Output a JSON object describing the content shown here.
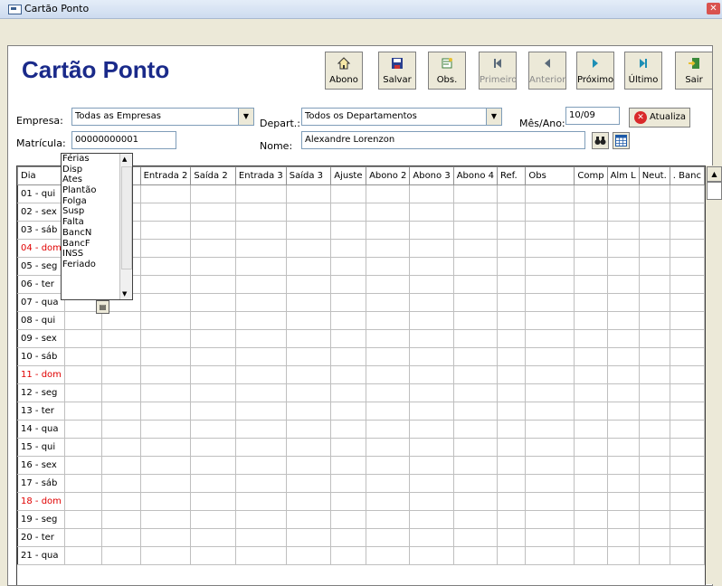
{
  "window": {
    "title": "Cartão Ponto",
    "close": "✕"
  },
  "header": {
    "title": "Cartão Ponto"
  },
  "toolbar": [
    {
      "label": "Abono",
      "icon": "house-icon",
      "enabled": true
    },
    {
      "label": "Salvar",
      "icon": "floppy-disk-icon",
      "enabled": true
    },
    {
      "label": "Obs.",
      "icon": "notes-icon",
      "enabled": true
    },
    {
      "label": "Primeiro",
      "icon": "first-record-icon",
      "enabled": false
    },
    {
      "label": "Anterior",
      "icon": "previous-record-icon",
      "enabled": false
    },
    {
      "label": "Próximo",
      "icon": "next-record-icon",
      "enabled": true
    },
    {
      "label": "Último",
      "icon": "last-record-icon",
      "enabled": true
    },
    {
      "label": "Sair",
      "icon": "exit-door-icon",
      "enabled": true
    }
  ],
  "form": {
    "empresa_label": "Empresa:",
    "empresa_value": "Todas as Empresas",
    "depart_label": "Depart.:",
    "depart_value": "Todos os Departamentos",
    "mesano_label": "Mês/Ano:",
    "mesano_value": "10/09",
    "atualiza_label": "Atualiza",
    "matricula_label": "Matrícula:",
    "matricula_value": "00000000001",
    "nome_label": "Nome:",
    "nome_value": "Alexandre Lorenzon"
  },
  "grid": {
    "headers": [
      "Dia",
      "",
      "1",
      "Entrada 2",
      "Saída 2",
      "Entrada 3",
      "Saída 3",
      "Ajuste",
      "Abono 2",
      "Abono 3",
      "Abono 4",
      "Ref.",
      "Obs",
      "Comp",
      "Alm L",
      "Neut.",
      ". Banc"
    ],
    "days": [
      {
        "label": "01 - qui",
        "sunday": false
      },
      {
        "label": "02 - sex",
        "sunday": false
      },
      {
        "label": "03 - sáb",
        "sunday": false
      },
      {
        "label": "04 - dom",
        "sunday": true
      },
      {
        "label": "05 - seg",
        "sunday": false
      },
      {
        "label": "06 - ter",
        "sunday": false
      },
      {
        "label": "07 - qua",
        "sunday": false
      },
      {
        "label": "08 - qui",
        "sunday": false
      },
      {
        "label": "09 - sex",
        "sunday": false
      },
      {
        "label": "10 - sáb",
        "sunday": false
      },
      {
        "label": "11 - dom",
        "sunday": true
      },
      {
        "label": "12 - seg",
        "sunday": false
      },
      {
        "label": "13 - ter",
        "sunday": false
      },
      {
        "label": "14 - qua",
        "sunday": false
      },
      {
        "label": "15 - qui",
        "sunday": false
      },
      {
        "label": "16 - sex",
        "sunday": false
      },
      {
        "label": "17 - sáb",
        "sunday": false
      },
      {
        "label": "18 - dom",
        "sunday": true
      },
      {
        "label": "19 - seg",
        "sunday": false
      },
      {
        "label": "20 - ter",
        "sunday": false
      },
      {
        "label": "21 - qua",
        "sunday": false
      }
    ]
  },
  "dropdown": {
    "items": [
      "Férias",
      "Disp",
      "Ates",
      "Plantão",
      "Folga",
      "Susp",
      "Falta",
      "BancN",
      "BancF",
      "INSS",
      "Feriado"
    ]
  },
  "colors": {
    "title": "#1a2a8a",
    "sunday": "#e00000",
    "atualiza": "#d9292a"
  }
}
